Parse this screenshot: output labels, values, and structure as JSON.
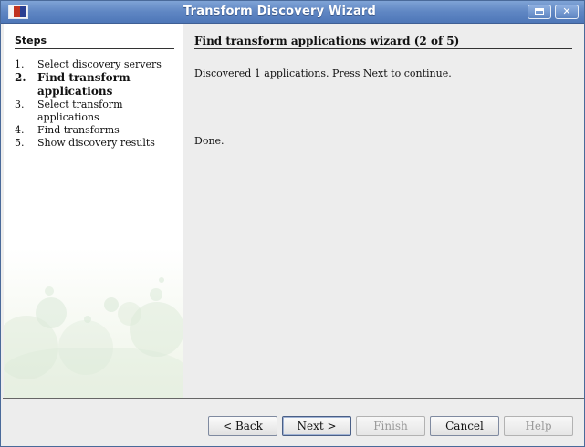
{
  "window": {
    "title": "Transform Discovery Wizard"
  },
  "sidebar": {
    "title": "Steps",
    "steps": [
      {
        "number": "1.",
        "label": "Select discovery servers"
      },
      {
        "number": "2.",
        "label": "Find transform applications"
      },
      {
        "number": "3.",
        "label": "Select transform applications"
      },
      {
        "number": "4.",
        "label": "Find transforms"
      },
      {
        "number": "5.",
        "label": "Show discovery results"
      }
    ]
  },
  "main": {
    "title": "Find transform applications wizard (2 of 5)",
    "message": "Discovered 1 applications. Press Next to continue.",
    "status": "Done."
  },
  "buttons": {
    "back": {
      "prefix": "< ",
      "mnemonic": "B",
      "rest": "ack"
    },
    "next": "Next >",
    "finish": {
      "mnemonic": "F",
      "rest": "inish"
    },
    "cancel": "Cancel",
    "help": {
      "mnemonic": "H",
      "rest": "elp"
    }
  }
}
